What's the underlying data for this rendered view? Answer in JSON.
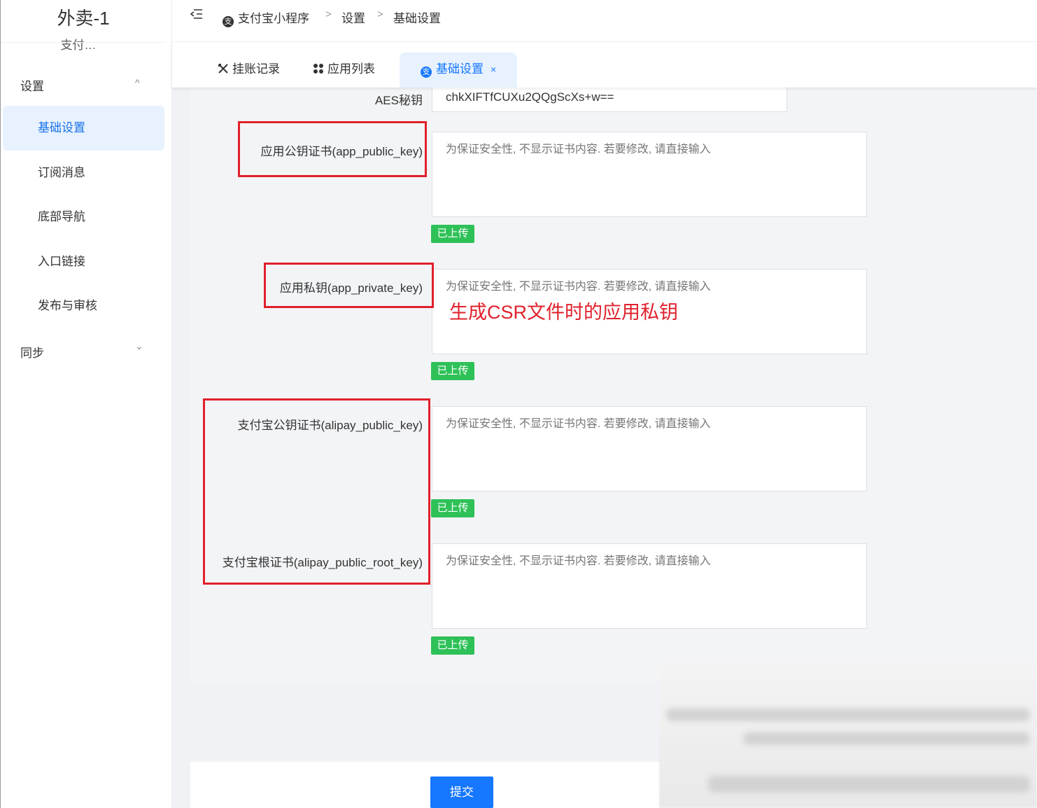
{
  "sidebar": {
    "app_title": "外卖-1",
    "app_subtitle": "支付…",
    "groups": [
      {
        "label": "设置",
        "chevron": "chevron-up-icon",
        "chevron_glyph": "^"
      },
      {
        "label": "同步",
        "chevron": "chevron-down-icon",
        "chevron_glyph": "⌄"
      }
    ],
    "items": [
      {
        "label": "基础设置",
        "active": true
      },
      {
        "label": "订阅消息"
      },
      {
        "label": "底部导航"
      },
      {
        "label": "入口链接"
      },
      {
        "label": "发布与审核"
      }
    ]
  },
  "breadcrumb": {
    "items": [
      "支付宝小程序",
      "设置",
      "基础设置"
    ],
    "separator": ">"
  },
  "tabs": [
    {
      "label": "挂账记录",
      "icon": "tools-icon"
    },
    {
      "label": "应用列表",
      "icon": "grid-icon"
    },
    {
      "label": "基础设置",
      "icon": "alipay-icon",
      "active": true,
      "close": "×"
    }
  ],
  "form": {
    "aes": {
      "label": "AES秘钥",
      "value": "chkXIFTfCUXu2QQgScXs+w=="
    },
    "fields": [
      {
        "label": "应用公钥证书(app_public_key)",
        "placeholder": "为保证安全性, 不显示证书内容. 若要修改, 请直接输入",
        "status": "已上传"
      },
      {
        "label": "应用私钥(app_private_key)",
        "placeholder": "为保证安全性, 不显示证书内容. 若要修改, 请直接输入",
        "status": "已上传"
      },
      {
        "label": "支付宝公钥证书(alipay_public_key)",
        "placeholder": "为保证安全性, 不显示证书内容. 若要修改, 请直接输入",
        "status": "已上传"
      },
      {
        "label": "支付宝根证书(alipay_public_root_key)",
        "placeholder": "为保证安全性, 不显示证书内容. 若要修改, 请直接输入",
        "status": "已上传"
      }
    ],
    "annotation": "生成CSR文件时的应用私钥",
    "submit_label": "提交"
  },
  "colors": {
    "accent": "#1677ff",
    "success_tag": "#2ec158",
    "annotation_red": "#e0212c",
    "active_bg": "#e8f2fe"
  }
}
